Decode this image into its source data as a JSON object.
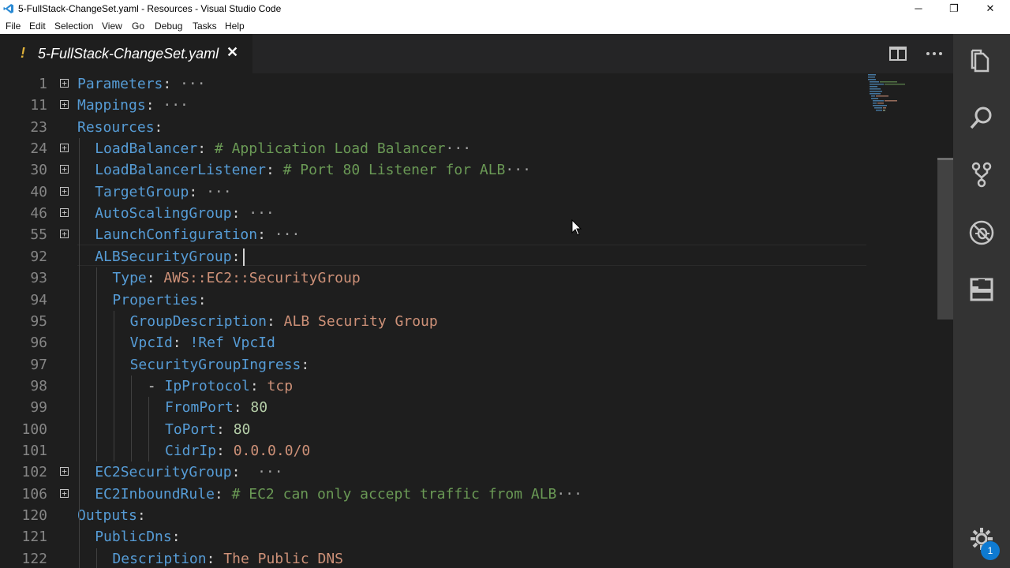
{
  "window": {
    "title": "5-FullStack-ChangeSet.yaml - Resources - Visual Studio Code",
    "controls": {
      "minimize": "─",
      "restore": "❐",
      "close": "✕"
    }
  },
  "menu": [
    "File",
    "Edit",
    "Selection",
    "View",
    "Go",
    "Debug",
    "Tasks",
    "Help"
  ],
  "tab": {
    "modified_marker": "!",
    "label": "5-FullStack-ChangeSet.yaml",
    "close": "✕"
  },
  "activity": [
    "explorer-icon",
    "search-icon",
    "source-control-icon",
    "debug-icon",
    "extensions-icon",
    "settings-gear-icon"
  ],
  "settings_badge": "1",
  "lines": [
    {
      "num": "1",
      "fold": true,
      "indent": 0,
      "key": "Parameters",
      "colon": ":",
      "rest": "",
      "rest_cls": "",
      "ell": " ···"
    },
    {
      "num": "11",
      "fold": true,
      "indent": 0,
      "key": "Mappings",
      "colon": ":",
      "rest": "",
      "rest_cls": "",
      "ell": " ···"
    },
    {
      "num": "23",
      "fold": false,
      "indent": 0,
      "key": "Resources",
      "colon": ":",
      "rest": "",
      "rest_cls": "",
      "ell": ""
    },
    {
      "num": "24",
      "fold": true,
      "indent": 1,
      "key": "LoadBalancer",
      "colon": ":",
      "rest": " # Application Load Balancer",
      "rest_cls": "c",
      "ell": "···"
    },
    {
      "num": "30",
      "fold": true,
      "indent": 1,
      "key": "LoadBalancerListener",
      "colon": ":",
      "rest": " # Port 80 Listener for ALB",
      "rest_cls": "c",
      "ell": "···"
    },
    {
      "num": "40",
      "fold": true,
      "indent": 1,
      "key": "TargetGroup",
      "colon": ":",
      "rest": "",
      "rest_cls": "",
      "ell": " ···"
    },
    {
      "num": "46",
      "fold": true,
      "indent": 1,
      "key": "AutoScalingGroup",
      "colon": ":",
      "rest": "",
      "rest_cls": "",
      "ell": " ···"
    },
    {
      "num": "55",
      "fold": true,
      "indent": 1,
      "key": "LaunchConfiguration",
      "colon": ":",
      "rest": "",
      "rest_cls": "",
      "ell": " ···"
    },
    {
      "num": "92",
      "fold": false,
      "indent": 1,
      "key": "ALBSecurityGroup",
      "colon": ":",
      "rest": "",
      "rest_cls": "",
      "ell": ""
    },
    {
      "num": "93",
      "fold": false,
      "indent": 2,
      "key": "Type",
      "colon": ":",
      "rest": " AWS::EC2::SecurityGroup",
      "rest_cls": "s",
      "ell": ""
    },
    {
      "num": "94",
      "fold": false,
      "indent": 2,
      "key": "Properties",
      "colon": ":",
      "rest": "",
      "rest_cls": "",
      "ell": ""
    },
    {
      "num": "95",
      "fold": false,
      "indent": 3,
      "key": "GroupDescription",
      "colon": ":",
      "rest": " ALB Security Group",
      "rest_cls": "s",
      "ell": ""
    },
    {
      "num": "96",
      "fold": false,
      "indent": 3,
      "key": "VpcId",
      "colon": ":",
      "rest": " !Ref VpcId",
      "rest_cls": "ref",
      "ell": ""
    },
    {
      "num": "97",
      "fold": false,
      "indent": 3,
      "key": "SecurityGroupIngress",
      "colon": ":",
      "rest": "",
      "rest_cls": "",
      "ell": ""
    },
    {
      "num": "98",
      "fold": false,
      "indent": 4,
      "dash": "- ",
      "key": "IpProtocol",
      "colon": ":",
      "rest": " tcp",
      "rest_cls": "s",
      "ell": ""
    },
    {
      "num": "99",
      "fold": false,
      "indent": 5,
      "key": "FromPort",
      "colon": ":",
      "rest": " 80",
      "rest_cls": "n",
      "ell": ""
    },
    {
      "num": "100",
      "fold": false,
      "indent": 5,
      "key": "ToPort",
      "colon": ":",
      "rest": " 80",
      "rest_cls": "n",
      "ell": ""
    },
    {
      "num": "101",
      "fold": false,
      "indent": 5,
      "key": "CidrIp",
      "colon": ":",
      "rest": " 0.0.0.0/0",
      "rest_cls": "s",
      "ell": ""
    },
    {
      "num": "102",
      "fold": true,
      "indent": 1,
      "key": "EC2SecurityGroup",
      "colon": ":",
      "rest": "",
      "rest_cls": "",
      "ell": "  ···"
    },
    {
      "num": "106",
      "fold": true,
      "indent": 1,
      "key": "EC2InboundRule",
      "colon": ":",
      "rest": " # EC2 can only accept traffic from ALB",
      "rest_cls": "c",
      "ell": "···"
    },
    {
      "num": "120",
      "fold": false,
      "indent": 0,
      "key": "Outputs",
      "colon": ":",
      "rest": "",
      "rest_cls": "",
      "ell": ""
    },
    {
      "num": "121",
      "fold": false,
      "indent": 1,
      "key": "PublicDns",
      "colon": ":",
      "rest": "",
      "rest_cls": "",
      "ell": ""
    },
    {
      "num": "122",
      "fold": false,
      "indent": 2,
      "key": "Description",
      "colon": ":",
      "rest": " The Public DNS",
      "rest_cls": "s",
      "ell": ""
    }
  ]
}
